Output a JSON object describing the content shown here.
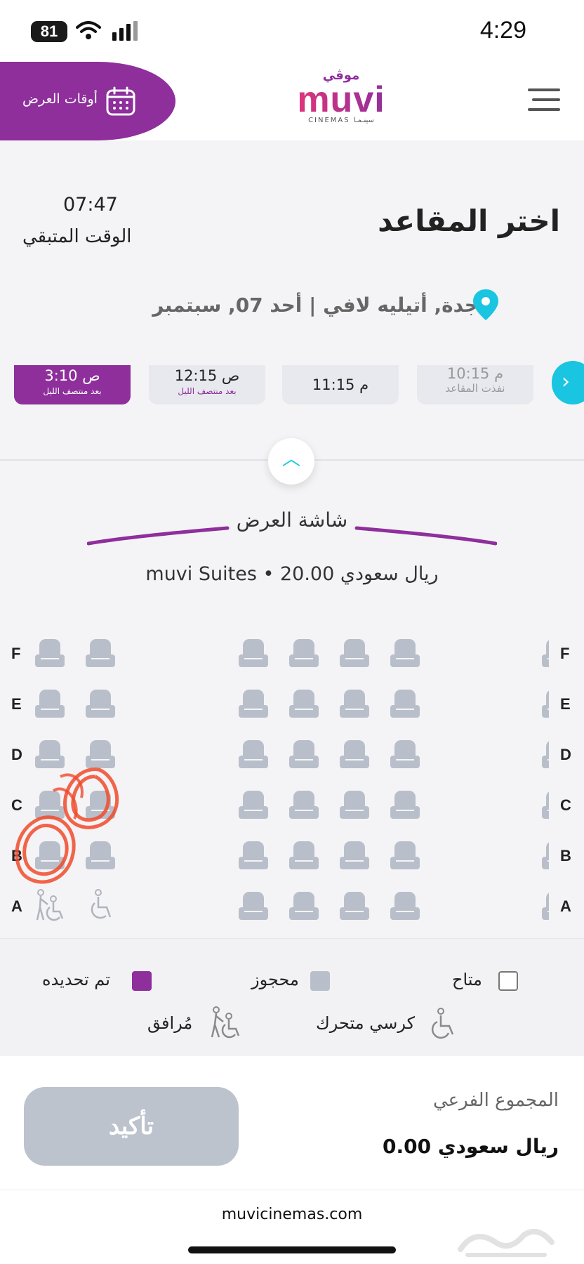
{
  "status_bar": {
    "time": "4:29",
    "battery": "81"
  },
  "header": {
    "showtimes_label": "أوقات العرض",
    "logo_arabic": "موڤي",
    "logo_main": "muvi",
    "logo_sub": "CINEMAS سينـمـا"
  },
  "page": {
    "title": "اختر المقاعد",
    "timer_value": "07:47",
    "timer_label": "الوقت المتبقي",
    "location": "جدة, أتيليه لافي | أحد 07, سبتمبر"
  },
  "showtimes": [
    {
      "time": "3:10 ص",
      "sub": "بعد منتصف الليل",
      "state": "selected"
    },
    {
      "time": "12:15 ص",
      "sub": "بعد منتصف الليل",
      "state": "available"
    },
    {
      "time": "11:15 م",
      "sub": "",
      "state": "available"
    },
    {
      "time": "10:15 م",
      "sub": "نفذت المقاعد",
      "state": "soldout"
    }
  ],
  "screen": {
    "label": "شاشة العرض",
    "price": "muvi Suites • 20.00 ريال سعودي"
  },
  "seatmap": {
    "rows": [
      "F",
      "E",
      "D",
      "C",
      "B",
      "A"
    ]
  },
  "legend": {
    "available": "متاح",
    "reserved": "محجوز",
    "selected": "تم تحديده",
    "wheelchair": "كرسي متحرك",
    "companion": "مُرافق"
  },
  "footer": {
    "subtotal_label": "المجموع الفرعي",
    "subtotal_value": "0.00 ريال سعودي",
    "confirm_label": "تأكيد",
    "site": "muvicinemas.com"
  },
  "colors": {
    "brand_purple": "#8e2f9c",
    "accent_cyan": "#19c5e0",
    "seat_gray": "#b9bfca"
  }
}
